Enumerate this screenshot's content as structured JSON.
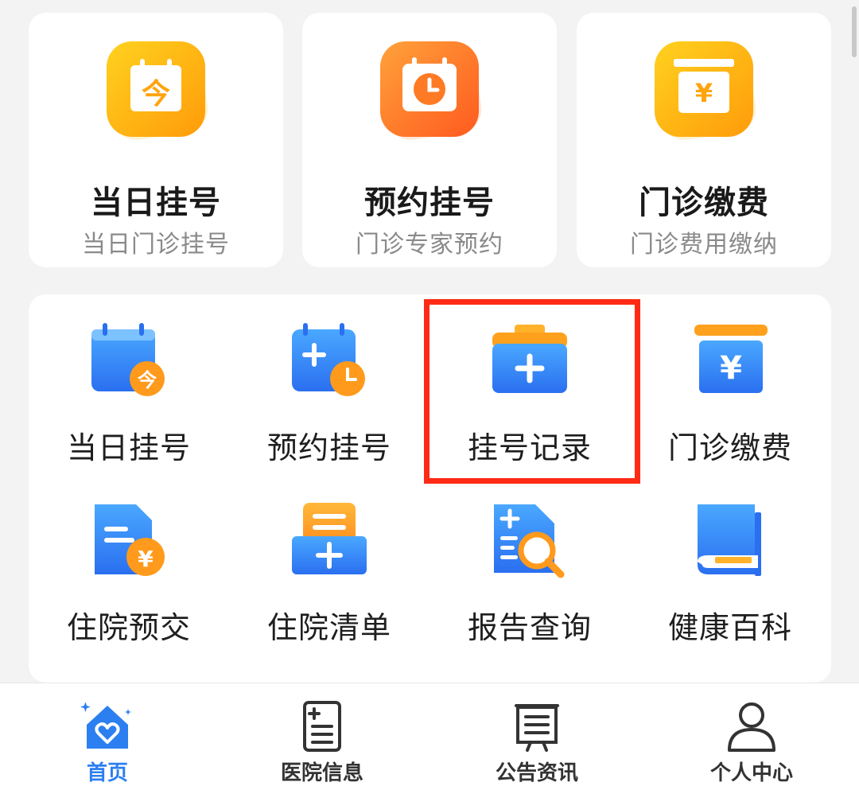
{
  "colors": {
    "accent_blue": "#2c7ff0",
    "orange": "#ff8a1c",
    "highlight_red": "#ff2a16"
  },
  "top_cards": [
    {
      "icon": "calendar-today-icon",
      "title": "当日挂号",
      "subtitle": "当日门诊挂号"
    },
    {
      "icon": "calendar-clock-icon",
      "title": "预约挂号",
      "subtitle": "门诊专家预约"
    },
    {
      "icon": "payment-box-icon",
      "title": "门诊缴费",
      "subtitle": "门诊费用缴纳"
    }
  ],
  "grid": [
    {
      "icon": "calendar-today-icon",
      "label": "当日挂号"
    },
    {
      "icon": "calendar-add-clock-icon",
      "label": "预约挂号"
    },
    {
      "icon": "medical-kit-icon",
      "label": "挂号记录"
    },
    {
      "icon": "yuan-payment-icon",
      "label": "门诊缴费"
    },
    {
      "icon": "document-yuan-icon",
      "label": "住院预交"
    },
    {
      "icon": "list-add-icon",
      "label": "住院清单"
    },
    {
      "icon": "report-search-icon",
      "label": "报告查询"
    },
    {
      "icon": "book-icon",
      "label": "健康百科"
    }
  ],
  "nav": [
    {
      "icon": "home-heart-icon",
      "label": "首页",
      "active": true
    },
    {
      "icon": "hospital-info-icon",
      "label": "医院信息",
      "active": false
    },
    {
      "icon": "announcement-board-icon",
      "label": "公告资讯",
      "active": false
    },
    {
      "icon": "user-icon",
      "label": "个人中心",
      "active": false
    }
  ],
  "icon_glyphs": {
    "today": "今",
    "yuan": "¥"
  }
}
